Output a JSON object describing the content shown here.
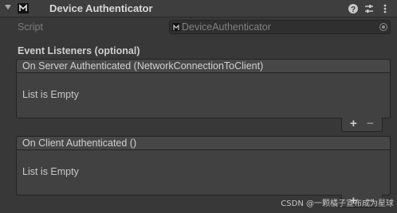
{
  "header": {
    "title": "Device Authenticator",
    "icons": [
      "foldout-arrow-icon",
      "component-script-icon",
      "help-icon",
      "preset-icon",
      "more-options-icon"
    ]
  },
  "script_row": {
    "label": "Script",
    "value": "DeviceAuthenticator"
  },
  "section_title": "Event Listeners (optional)",
  "events": [
    {
      "header": "On Server Authenticated (NetworkConnectionToClient)",
      "empty_label": "List is Empty",
      "add": "+",
      "remove": "−"
    },
    {
      "header": "On Client Authenticated ()",
      "empty_label": "List is Empty",
      "add": "+",
      "remove": "−"
    }
  ],
  "watermark": "CSDN @一颗橘子宣布成为星球",
  "colors": {
    "background": "#383838",
    "header": "#3e3e3e",
    "panel": "#414141"
  }
}
